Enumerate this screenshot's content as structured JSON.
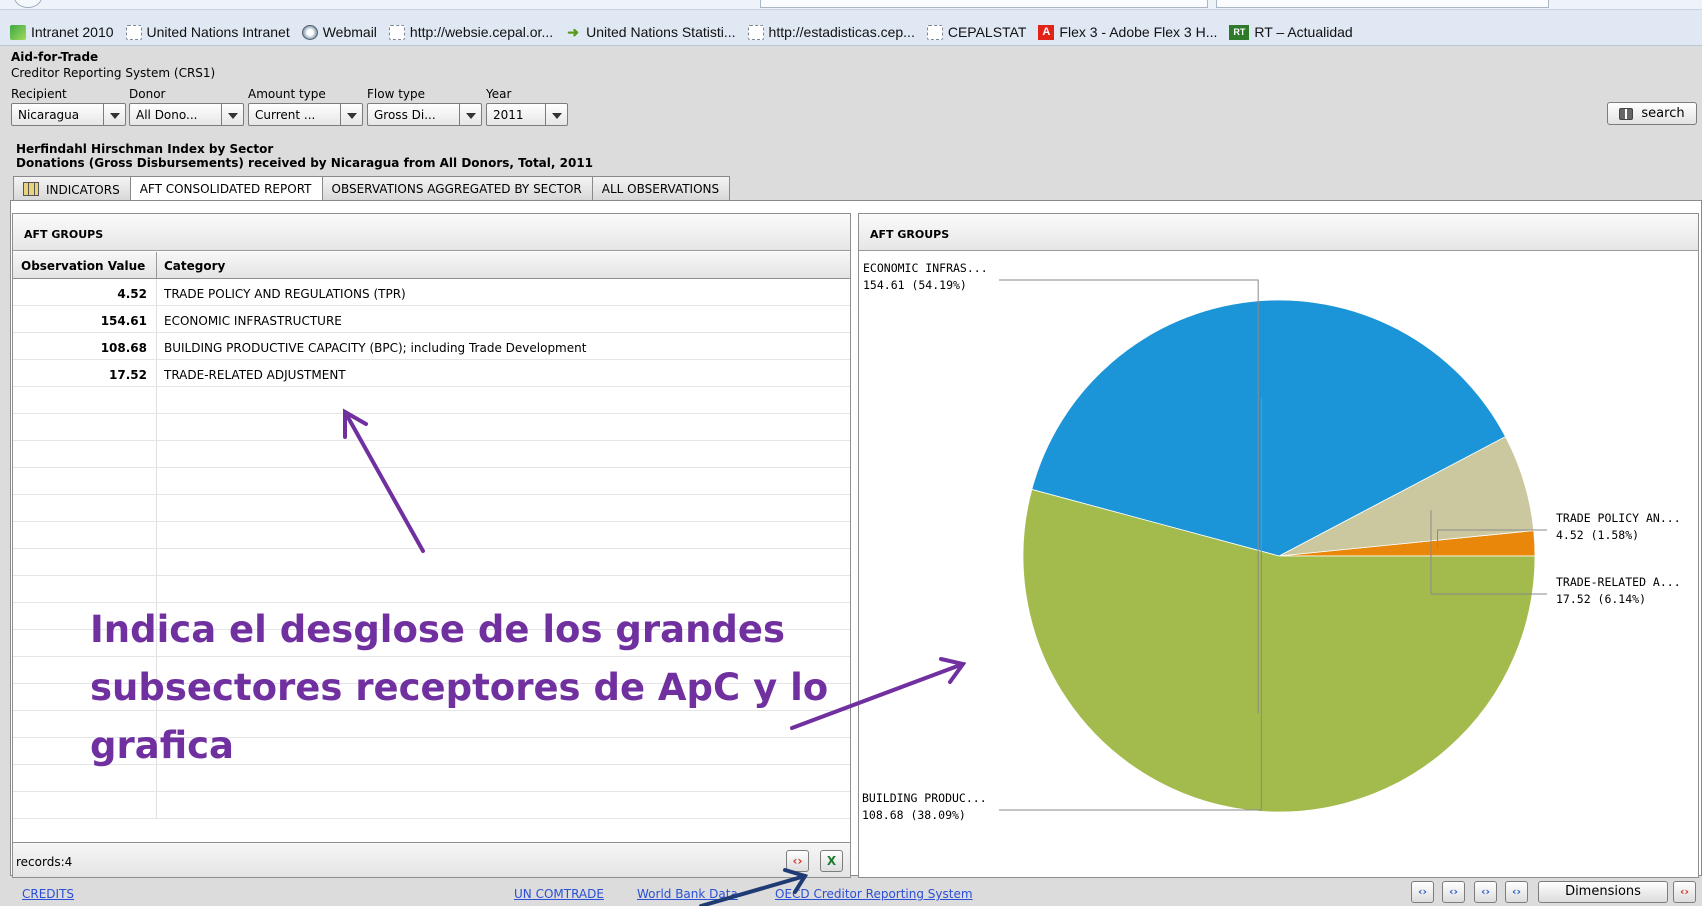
{
  "bookmarks": [
    {
      "label": "Intranet 2010",
      "icon": "green-page-icon"
    },
    {
      "label": "United Nations Intranet",
      "icon": "page-icon"
    },
    {
      "label": "Webmail",
      "icon": "un-logo-icon"
    },
    {
      "label": "http://websie.cepal.or...",
      "icon": "page-icon"
    },
    {
      "label": "United Nations Statisti...",
      "icon": "arrow-icon"
    },
    {
      "label": "http://estadisticas.cep...",
      "icon": "page-icon"
    },
    {
      "label": "CEPALSTAT",
      "icon": "page-icon"
    },
    {
      "label": "Flex 3 - Adobe Flex 3 H...",
      "icon": "adobe-icon"
    },
    {
      "label": "RT – Actualidad",
      "icon": "rt-icon"
    }
  ],
  "app": {
    "title": "Aid-for-Trade",
    "subtitle": "Creditor Reporting System (CRS1)"
  },
  "filters": [
    {
      "label": "Recipient",
      "value": "Nicaragua"
    },
    {
      "label": "Donor",
      "value": "All Dono..."
    },
    {
      "label": "Amount type",
      "value": "Current ..."
    },
    {
      "label": "Flow type",
      "value": "Gross Di..."
    },
    {
      "label": "Year",
      "value": "2011"
    }
  ],
  "search_label": "search",
  "report": {
    "title": "Herfindahl Hirschman Index by Sector",
    "subtitle": "Donations (Gross Disbursements) received by Nicaragua from All Donors, Total, 2011"
  },
  "tabs": [
    {
      "label": "INDICATORS",
      "active": false
    },
    {
      "label": "AFT CONSOLIDATED REPORT",
      "active": true
    },
    {
      "label": "OBSERVATIONS AGGREGATED BY SECTOR",
      "active": false
    },
    {
      "label": "ALL OBSERVATIONS",
      "active": false
    }
  ],
  "left_panel": {
    "title": "AFT GROUPS",
    "columns": [
      "Observation Value",
      "Category"
    ],
    "rows": [
      {
        "value": "4.52",
        "category": "TRADE POLICY AND REGULATIONS (TPR)"
      },
      {
        "value": "154.61",
        "category": "ECONOMIC INFRASTRUCTURE"
      },
      {
        "value": "108.68",
        "category": "BUILDING PRODUCTIVE CAPACITY (BPC); including Trade Development"
      },
      {
        "value": "17.52",
        "category": "TRADE-RELATED ADJUSTMENT"
      }
    ],
    "records": "records:4"
  },
  "right_panel": {
    "title": "AFT GROUPS"
  },
  "chart_data": {
    "type": "pie",
    "title": "AFT GROUPS",
    "slices": [
      {
        "label": "TRADE POLICY AN...",
        "value": 4.52,
        "percent": "1.58%",
        "color": "#e8870a"
      },
      {
        "label": "TRADE-RELATED A...",
        "value": 17.52,
        "percent": "6.14%",
        "color": "#cbc8a0"
      },
      {
        "label": "BUILDING PRODUC...",
        "value": 108.68,
        "percent": "38.09%",
        "color": "#1c95d8"
      },
      {
        "label": "ECONOMIC INFRAS...",
        "value": 154.61,
        "percent": "54.19%",
        "color": "#a3bb4d"
      }
    ],
    "slice_labels": [
      {
        "name": "ECONOMIC INFRAS...",
        "detail": "154.61 (54.19%)"
      },
      {
        "name": "TRADE POLICY AN...",
        "detail": "4.52 (1.58%)"
      },
      {
        "name": "TRADE-RELATED A...",
        "detail": "17.52 (6.14%)"
      },
      {
        "name": "BUILDING PRODUC...",
        "detail": "108.68 (38.09%)"
      }
    ]
  },
  "footer": {
    "credits": "CREDITS",
    "links": [
      "UN COMTRADE",
      "World Bank Data",
      "OECD Creditor Reporting System"
    ],
    "dimensions_label": "Dimensions"
  },
  "annotation": {
    "text": "Indica el desglose de los grandes subsectores receptores de ApC y lo grafica",
    "color": "#7030a0"
  }
}
